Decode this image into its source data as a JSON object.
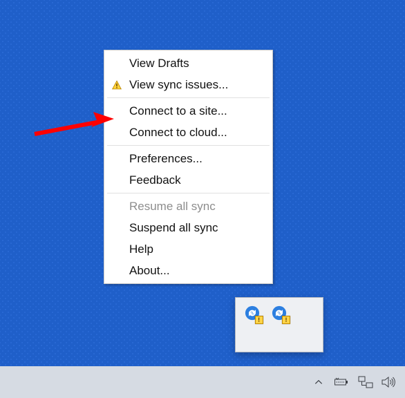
{
  "menu": {
    "items": [
      {
        "label": "View Drafts",
        "icon": null,
        "disabled": false
      },
      {
        "label": "View sync issues...",
        "icon": "warning-icon",
        "disabled": false
      },
      {
        "sep": true
      },
      {
        "label": "Connect to a site...",
        "icon": null,
        "disabled": false
      },
      {
        "label": "Connect to cloud...",
        "icon": null,
        "disabled": false
      },
      {
        "sep": true
      },
      {
        "label": "Preferences...",
        "icon": null,
        "disabled": false
      },
      {
        "label": "Feedback",
        "icon": null,
        "disabled": false
      },
      {
        "sep": true
      },
      {
        "label": "Resume all sync",
        "icon": null,
        "disabled": true
      },
      {
        "label": "Suspend all sync",
        "icon": null,
        "disabled": false
      },
      {
        "label": "Help",
        "icon": null,
        "disabled": false
      },
      {
        "label": "About...",
        "icon": null,
        "disabled": false
      }
    ]
  },
  "annotation": {
    "arrow_target_label": "Connect to a site..."
  },
  "tray_popup": {
    "icons": [
      {
        "name": "sync-app-icon",
        "warning": true
      },
      {
        "name": "sync-app-icon",
        "warning": true
      }
    ]
  },
  "taskbar": {
    "icons": [
      {
        "name": "tray-chevron-up-icon"
      },
      {
        "name": "power-icon"
      },
      {
        "name": "network-icon"
      },
      {
        "name": "volume-icon"
      }
    ]
  }
}
